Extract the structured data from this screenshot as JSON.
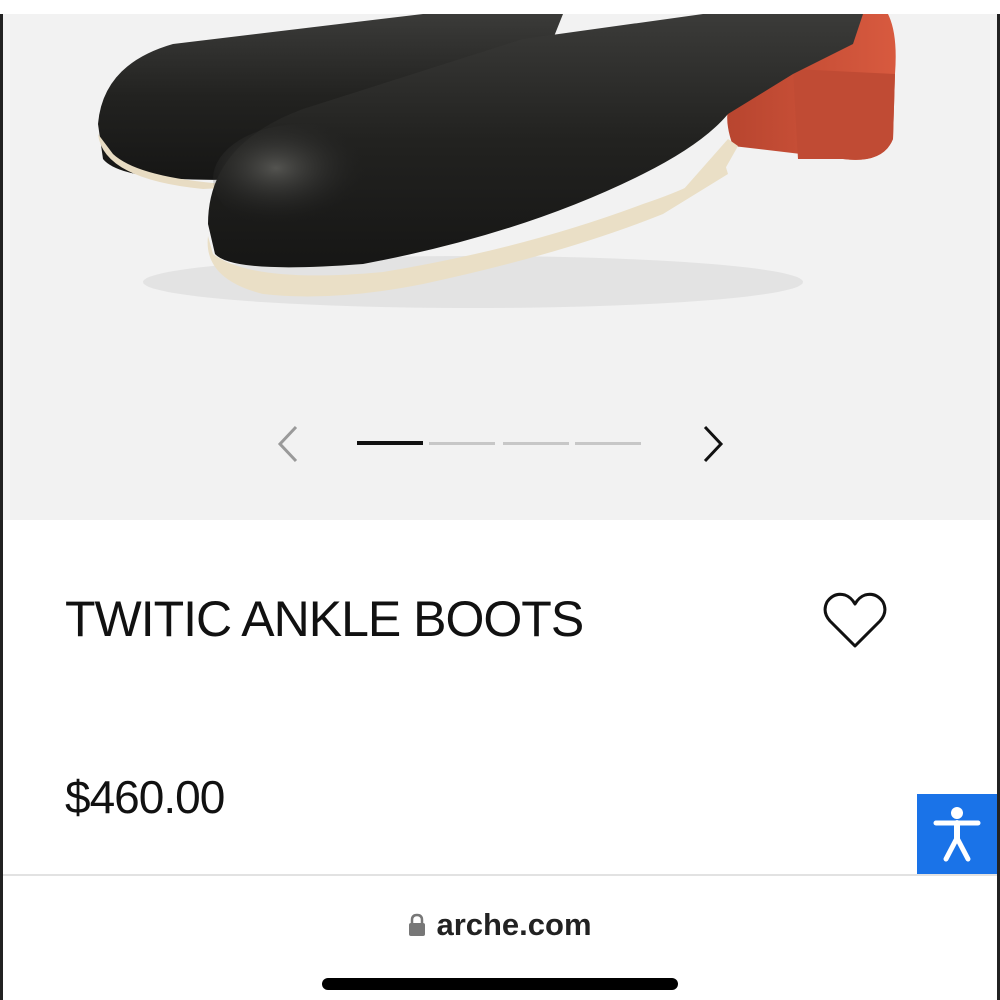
{
  "product": {
    "title": "TWITIC ANKLE BOOTS",
    "price": "$460.00",
    "image_alt": "black leather ankle boots with red heel"
  },
  "gallery": {
    "slide_count": 4,
    "active_index": 0,
    "prev_icon": "chevron-left-icon",
    "next_icon": "chevron-right-icon"
  },
  "browser": {
    "domain": "arche.com",
    "lock_icon": "lock-icon"
  },
  "accessibility": {
    "icon": "accessibility-icon",
    "color": "#1a73e8"
  }
}
